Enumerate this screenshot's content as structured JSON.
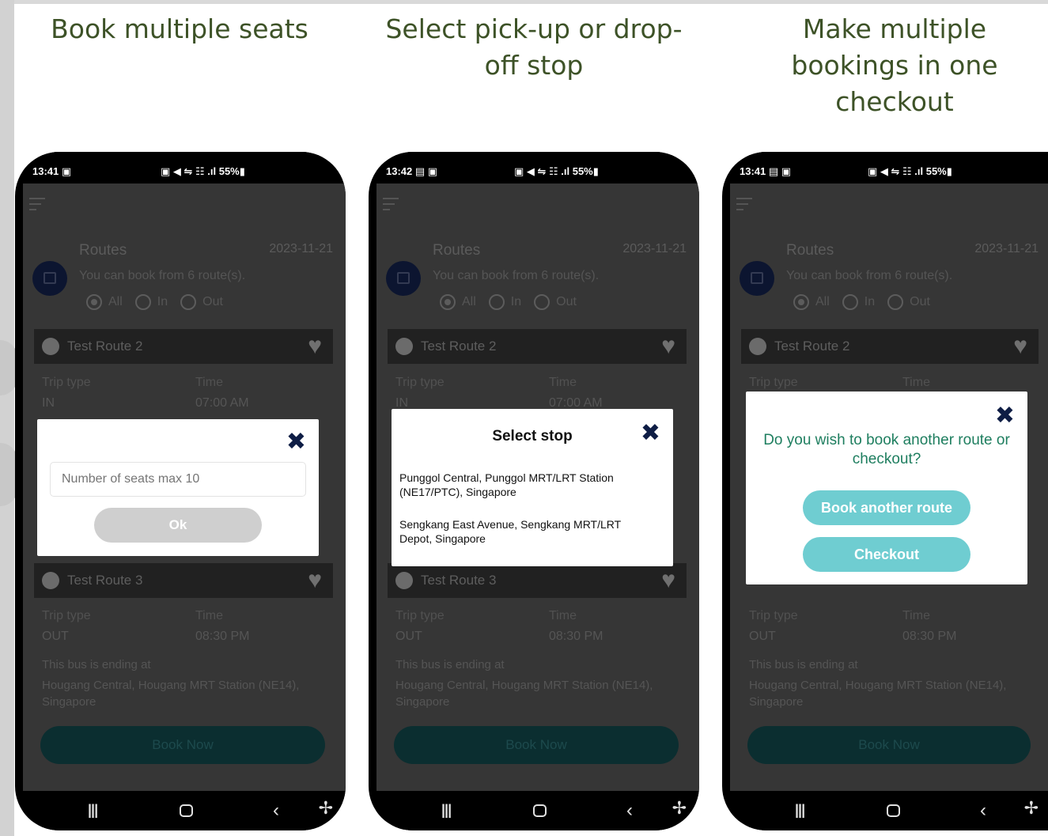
{
  "captions": [
    "Book multiple seats",
    "Select pick-up or drop-off stop",
    "Make multiple bookings in one checkout"
  ],
  "phones": [
    {
      "status_time": "13:41",
      "status_icons": "▣",
      "status_right": "▣ ◀ ⇋ ☷ .ıl 55%▮",
      "routes_title": "Routes",
      "date": "2023-11-21",
      "routes_sub": "You can book from 6 route(s).",
      "radio": [
        "All",
        "In",
        "Out"
      ],
      "route1_name": "Test Route 2",
      "trip_type_label": "Trip type",
      "time_label": "Time",
      "trip1_type": "IN",
      "trip1_time": "07:00 AM",
      "route2_name": "Test Route 3",
      "trip2_type": "OUT",
      "trip2_time": "08:30 PM",
      "ending_label": "This bus is ending at",
      "ending_place": "Hougang Central, Hougang MRT Station (NE14), Singapore",
      "book_now": "Book Now",
      "modal": {
        "close": "✖",
        "placeholder": "Number of seats max 10",
        "ok": "Ok"
      }
    },
    {
      "status_time": "13:42",
      "status_icons": "▤ ▣",
      "status_right": "▣ ◀ ⇋ ☷ .ıl 55%▮",
      "routes_title": "Routes",
      "date": "2023-11-21",
      "routes_sub": "You can book from 6 route(s).",
      "radio": [
        "All",
        "In",
        "Out"
      ],
      "route1_name": "Test Route 2",
      "trip_type_label": "Trip type",
      "time_label": "Time",
      "trip1_type": "IN",
      "trip1_time": "07:00 AM",
      "route2_name": "Test Route 3",
      "trip2_type": "OUT",
      "trip2_time": "08:30 PM",
      "ending_label": "This bus is ending at",
      "ending_place": "Hougang Central, Hougang MRT Station (NE14), Singapore",
      "book_now": "Book Now",
      "modal": {
        "close": "✖",
        "title": "Select stop",
        "stops": [
          "Punggol Central, Punggol MRT/LRT Station (NE17/PTC), Singapore",
          "Sengkang East Avenue, Sengkang MRT/LRT Depot, Singapore"
        ]
      }
    },
    {
      "status_time": "13:41",
      "status_icons": "▤ ▣",
      "status_right": "▣ ◀ ⇋ ☷ .ıl 55%▮",
      "routes_title": "Routes",
      "date": "2023-11-21",
      "routes_sub": "You can book from 6 route(s).",
      "radio": [
        "All",
        "In",
        "Out"
      ],
      "route1_name": "Test Route 2",
      "trip_type_label": "Trip type",
      "time_label": "Time",
      "trip2_type": "OUT",
      "trip2_time": "08:30 PM",
      "ending_label": "This bus is ending at",
      "ending_place": "Hougang Central, Hougang MRT Station (NE14), Singapore",
      "book_now": "Book Now",
      "modal": {
        "close": "✖",
        "question": "Do you wish to book another route or checkout?",
        "book_another": "Book another route",
        "checkout": "Checkout"
      }
    }
  ],
  "nav": {
    "recent": "|||",
    "back": "‹",
    "accessibility": "✢"
  }
}
